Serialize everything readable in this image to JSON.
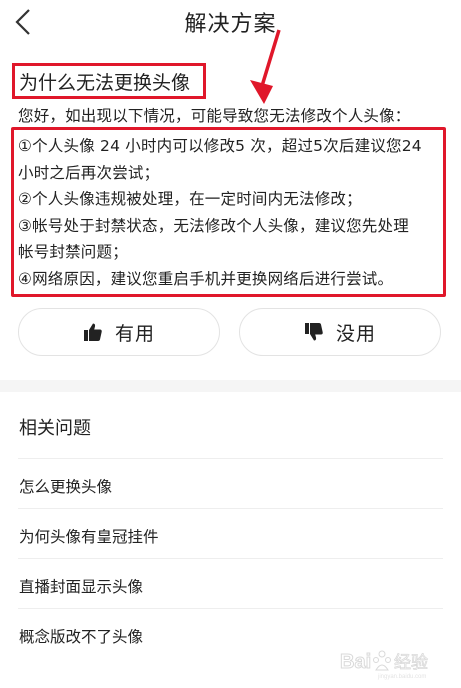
{
  "header": {
    "back_icon": "chevron-left-icon",
    "title": "解决方案"
  },
  "question": {
    "title": "为什么无法更换头像"
  },
  "answer": {
    "intro": "您好，如出现以下情况，可能导致您无法修改个人头像：",
    "lines": [
      "①个人头像 24 小时内可以修改5 次，超过5次后建议您24",
      "小时之后再次尝试；",
      "②个人头像违规被处理，在一定时间内无法修改；",
      "③帐号处于封禁状态，无法修改个人头像，建议您先处理",
      "帐号封禁问题；",
      "④网络原因，建议您重启手机并更换网络后进行尝试。"
    ]
  },
  "feedback": {
    "useful_label": "有用",
    "useful_icon": "thumbs-up-icon",
    "useless_label": "没用",
    "useless_icon": "thumbs-down-icon"
  },
  "related": {
    "title": "相关问题",
    "items": [
      "怎么更换头像",
      "为何头像有皇冠挂件",
      "直播封面显示头像",
      "概念版改不了头像"
    ]
  },
  "colors": {
    "annotation_red": "#e0172a",
    "text": "#222222",
    "divider": "#eeeeee",
    "band": "#f5f5f5"
  },
  "watermark": {
    "text": "Baidu 经验"
  }
}
